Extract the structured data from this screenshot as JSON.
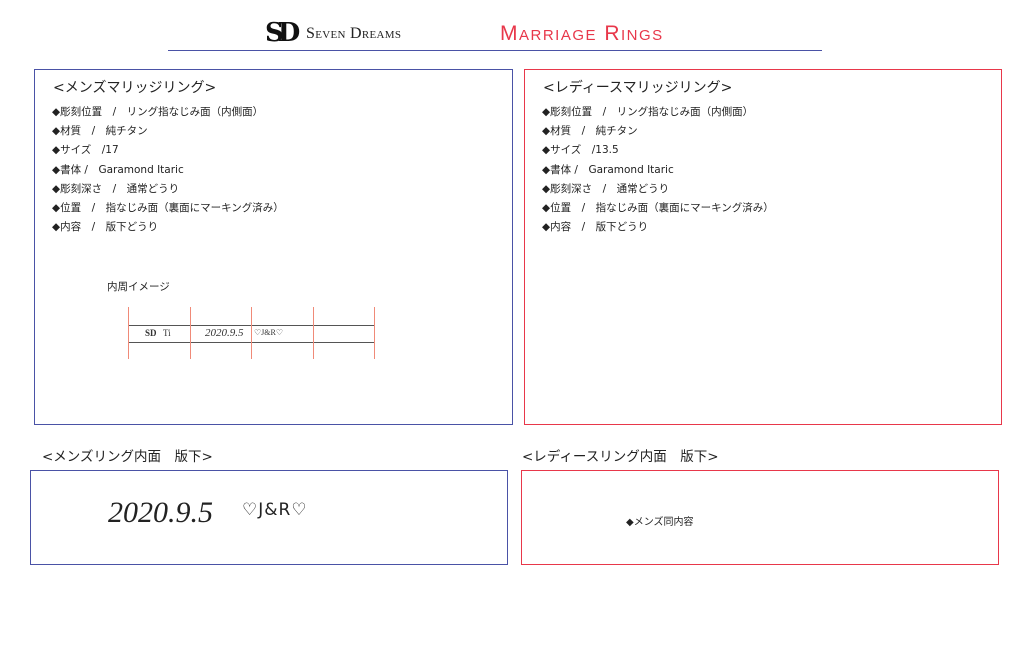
{
  "header": {
    "logo_mark": "SD",
    "brand_name": "Seven Dreams",
    "title": "Marriage Rings",
    "colors": {
      "accent_blue": "#4a52a6",
      "accent_red": "#e8374a"
    }
  },
  "mens_ring": {
    "heading": "<メンズマリッジリング>",
    "specs": [
      "◆彫刻位置　/　リング指なじみ面（内側面）",
      "◆材質　/　純チタン",
      "◆サイズ　/17",
      "◆書体 /　Garamond Itaric",
      "◆彫刻深さ　/　通常どうり",
      "◆位置　/　指なじみ面（裏面にマーキング済み）",
      "◆内容　/　版下どうり"
    ],
    "inner_image": {
      "label": "内周イメージ",
      "logo": "SD",
      "material": "Ti",
      "date": "2020.9.5",
      "initials": "♡J&R♡"
    }
  },
  "ladies_ring": {
    "heading": "<レディースマリッジリング>",
    "specs": [
      "◆彫刻位置　/　リング指なじみ面（内側面）",
      "◆材質　/　純チタン",
      "◆サイズ　/13.5",
      "◆書体 /　Garamond Itaric",
      "◆彫刻深さ　/　通常どうり",
      "◆位置　/　指なじみ面（裏面にマーキング済み）",
      "◆内容　/　版下どうり"
    ]
  },
  "mens_plate": {
    "label": "<メンズリング内面　版下>",
    "date": "2020.9.5",
    "initials": "♡J&R♡"
  },
  "ladies_plate": {
    "label": "<レディースリング内面　版下>",
    "note": "◆メンズ同内容"
  }
}
